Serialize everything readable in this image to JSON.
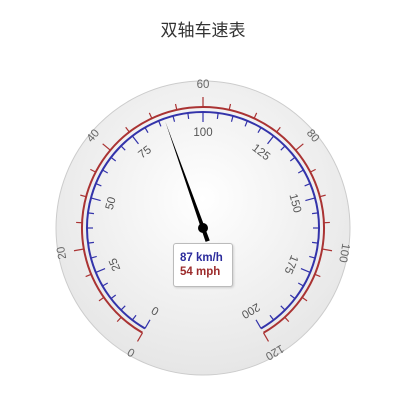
{
  "title": "双轴车速表",
  "chart_data": {
    "type": "gauge",
    "title": "双轴车速表",
    "series": [
      {
        "name": "km/h",
        "unit": "km/h",
        "value": 87,
        "readout": "87 km/h",
        "color": "#3333aa",
        "range": [
          0,
          200
        ],
        "major_ticks": [
          0,
          25,
          50,
          75,
          100,
          125,
          150,
          175,
          200
        ],
        "minor_step": 5,
        "labels": [
          "0",
          "25",
          "50",
          "75",
          "100",
          "125",
          "150",
          "175",
          "200"
        ],
        "placement": "inner"
      },
      {
        "name": "mph",
        "unit": "mph",
        "value": 54,
        "readout": "54 mph",
        "color": "#aa3333",
        "range": [
          0,
          120
        ],
        "major_ticks": [
          0,
          20,
          40,
          60,
          80,
          100,
          120
        ],
        "minor_step": 5,
        "labels": [
          "0",
          "20",
          "40",
          "60",
          "80",
          "100",
          "120"
        ],
        "placement": "outer"
      }
    ],
    "needle_value_kmh": 87,
    "needle_color": "#000000"
  },
  "readout": {
    "kmh": "87 km/h",
    "mph": "54 mph"
  }
}
